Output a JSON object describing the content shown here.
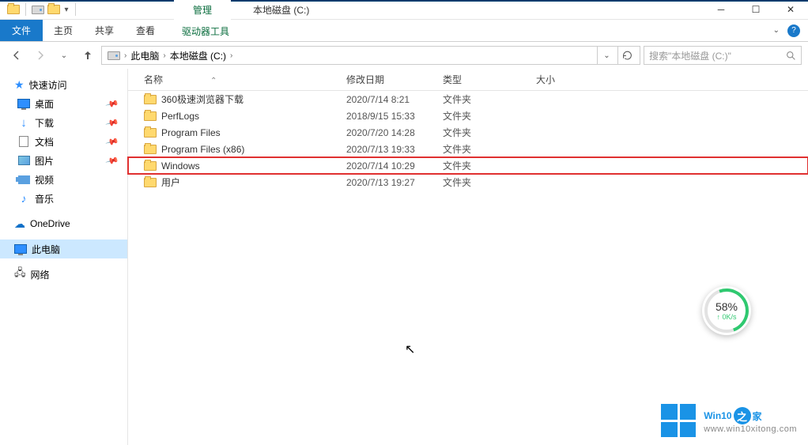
{
  "window": {
    "title": "本地磁盘 (C:)",
    "manage_tab": "管理"
  },
  "ribbon": {
    "file": "文件",
    "tabs": [
      "主页",
      "共享",
      "查看"
    ],
    "drive_tools": "驱动器工具"
  },
  "address": {
    "segments": [
      "此电脑",
      "本地磁盘 (C:)"
    ]
  },
  "search": {
    "placeholder": "搜索\"本地磁盘 (C:)\""
  },
  "columns": {
    "name": "名称",
    "date": "修改日期",
    "type": "类型",
    "size": "大小"
  },
  "sidebar": {
    "quick_access": "快速访问",
    "items": [
      {
        "label": "桌面",
        "icon": "monitor",
        "pinned": true
      },
      {
        "label": "下载",
        "icon": "download",
        "pinned": true
      },
      {
        "label": "文档",
        "icon": "doc",
        "pinned": true
      },
      {
        "label": "图片",
        "icon": "pic",
        "pinned": true
      },
      {
        "label": "视频",
        "icon": "vid",
        "pinned": false
      },
      {
        "label": "音乐",
        "icon": "music",
        "pinned": false
      }
    ],
    "onedrive": "OneDrive",
    "this_pc": "此电脑",
    "network": "网络"
  },
  "rows": [
    {
      "name": "360极速浏览器下载",
      "date": "2020/7/14 8:21",
      "type": "文件夹",
      "highlighted": false
    },
    {
      "name": "PerfLogs",
      "date": "2018/9/15 15:33",
      "type": "文件夹",
      "highlighted": false
    },
    {
      "name": "Program Files",
      "date": "2020/7/20 14:28",
      "type": "文件夹",
      "highlighted": false
    },
    {
      "name": "Program Files (x86)",
      "date": "2020/7/13 19:33",
      "type": "文件夹",
      "highlighted": false
    },
    {
      "name": "Windows",
      "date": "2020/7/14 10:29",
      "type": "文件夹",
      "highlighted": true
    },
    {
      "name": "用户",
      "date": "2020/7/13 19:27",
      "type": "文件夹",
      "highlighted": false
    }
  ],
  "speed": {
    "pct": "58%",
    "sub": "↑ 0K/s"
  },
  "watermark": {
    "brand_a": "Win10",
    "brand_b": "之",
    "brand_c": "家",
    "url": "www.win10xitong.com"
  }
}
